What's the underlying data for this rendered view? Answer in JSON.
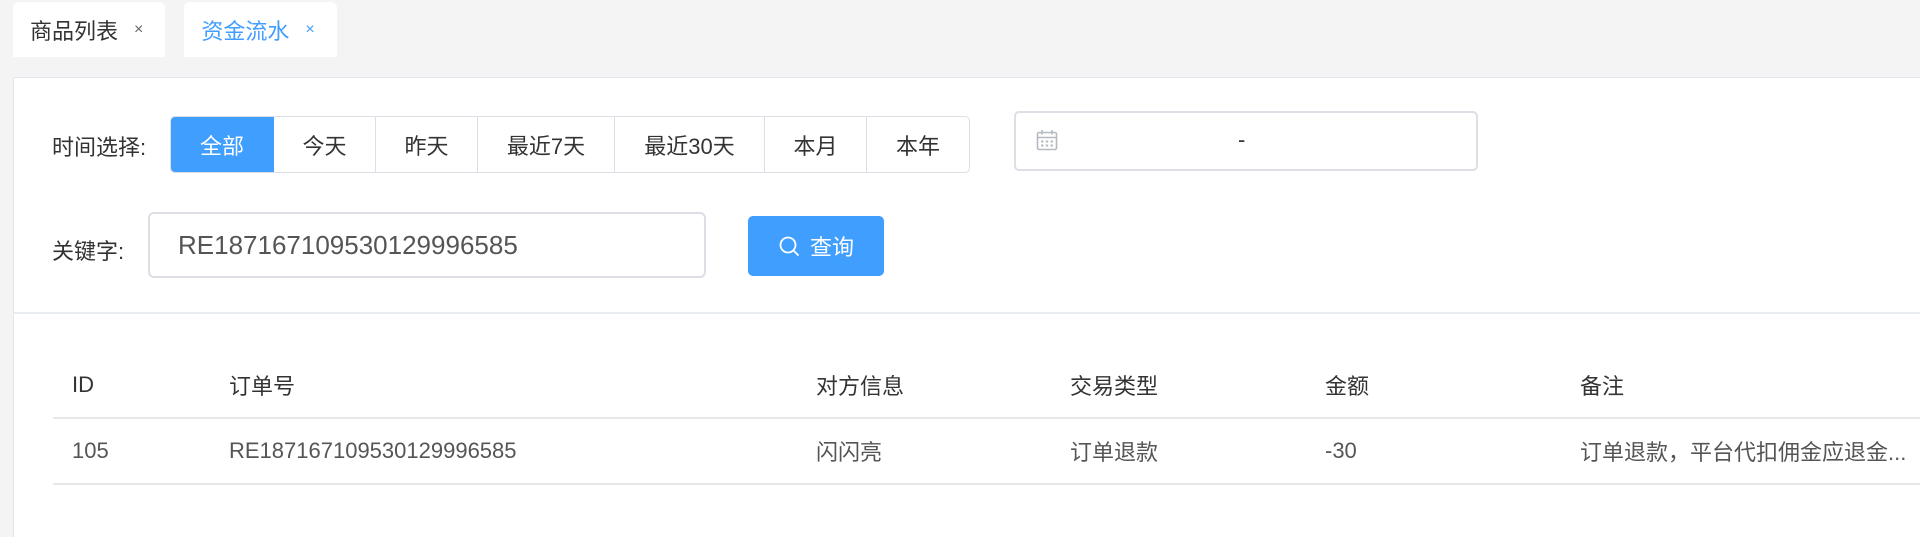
{
  "tabs": [
    {
      "label": "商品列表",
      "close": "×"
    },
    {
      "label": "资金流水",
      "close": "×"
    }
  ],
  "filters": {
    "time_label": "时间选择:",
    "time_options": [
      "全部",
      "今天",
      "昨天",
      "最近7天",
      "最近30天",
      "本月",
      "本年"
    ],
    "selected_time": "全部",
    "date_range_separator": "-",
    "keyword_label": "关键字:",
    "keyword_value": "RE18716710953012999 6585",
    "search_label": "查询"
  },
  "table": {
    "headers": [
      "ID",
      "订单号",
      "对方信息",
      "交易类型",
      "金额",
      "备注"
    ],
    "rows": [
      [
        "105",
        "RE187167109530129996585",
        "闪闪亮",
        "订单退款",
        "-30",
        "订单退款，平台代扣佣金应退金..."
      ]
    ]
  },
  "colors": {
    "accent": "#409eff",
    "page_bg": "#f4f4f4",
    "border": "#dcdfe6"
  },
  "icons": {
    "date": "calendar-icon",
    "search": "search-icon"
  }
}
